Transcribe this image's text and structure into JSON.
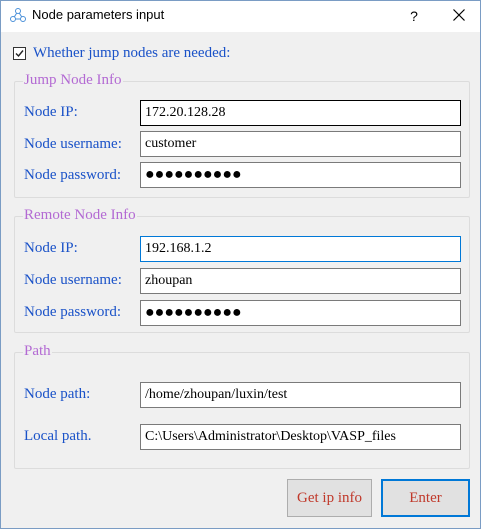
{
  "window": {
    "title": "Node parameters input",
    "help_label": "?",
    "close_icon": "close-icon",
    "app_icon": "network-icon"
  },
  "jump_toggle": {
    "label": "Whether jump nodes are needed:",
    "checked": true
  },
  "jump_node": {
    "title": "Jump Node Info",
    "ip_label": "Node IP:",
    "ip_value": "172.20.128.28",
    "username_label": "Node username:",
    "username_value": "customer",
    "password_label": "Node password:",
    "password_value": "●●●●●●●●●●"
  },
  "remote_node": {
    "title": "Remote Node Info",
    "ip_label": "Node IP:",
    "ip_value": "192.168.1.2",
    "username_label": "Node username:",
    "username_value": "zhoupan",
    "password_label": "Node password:",
    "password_value": "●●●●●●●●●●"
  },
  "path": {
    "title": "Path",
    "node_path_label": "Node path:",
    "node_path_value": "/home/zhoupan/luxin/test",
    "local_path_label": "Local path.",
    "local_path_value": "C:\\Users\\Administrator\\Desktop\\VASP_files"
  },
  "buttons": {
    "get_ip_label": "Get ip info",
    "enter_label": "Enter"
  },
  "colors": {
    "label_blue": "#1a52c8",
    "group_title_purple": "#b36ad3",
    "button_text_red": "#c0392b",
    "focus_blue": "#0078d7"
  }
}
